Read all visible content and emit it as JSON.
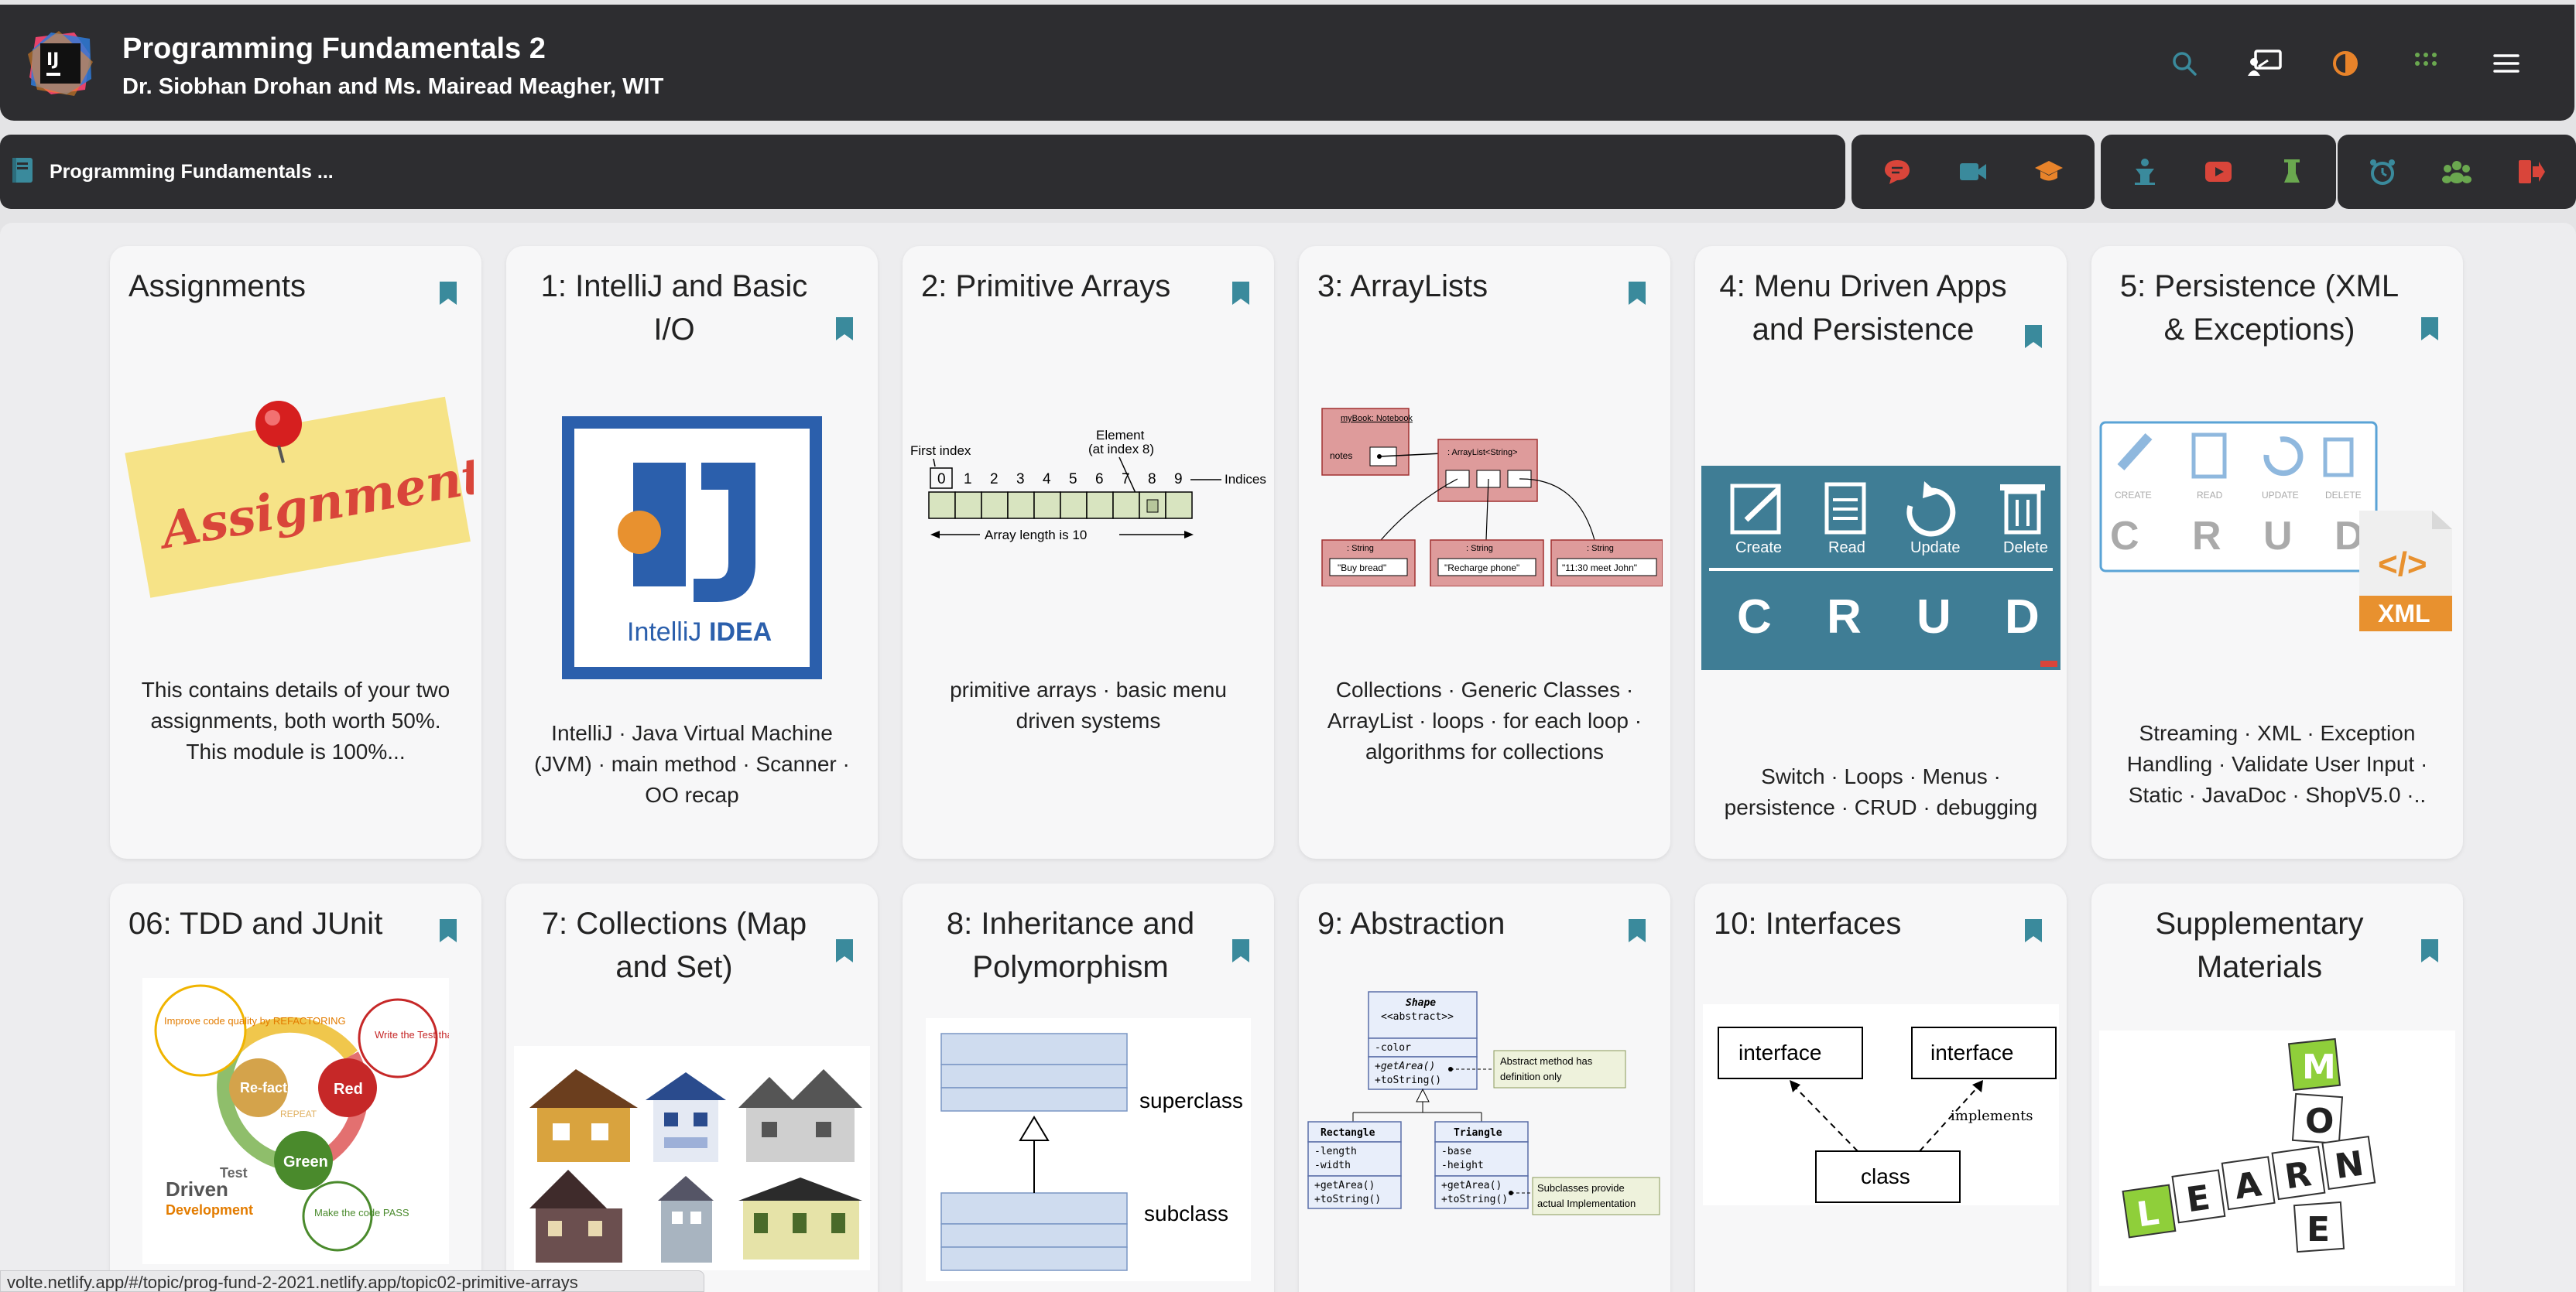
{
  "header": {
    "logo_text": "IJ",
    "title": "Programming Fundamentals 2",
    "subtitle": "Dr. Siobhan Drohan and Ms. Mairead Meagher, WIT",
    "icons": [
      "search-icon",
      "presentation-icon",
      "theme-toggle-icon",
      "apps-grid-icon",
      "menu-icon"
    ]
  },
  "nav": {
    "title": "Programming Fundamentals ...",
    "group1": [
      "chat-icon",
      "video-icon",
      "graduation-cap-icon"
    ],
    "group2": [
      "person-icon",
      "youtube-icon",
      "beaker-icon"
    ],
    "group3": [
      "alarm-icon",
      "group-icon",
      "logout-icon"
    ]
  },
  "colors": {
    "header_bg": "#2d2d30",
    "accent_teal": "#3a8a9c",
    "accent_orange": "#e8832a",
    "accent_red": "#d9453a",
    "accent_green": "#4caf50"
  },
  "cards": [
    {
      "title": "Assignments",
      "desc": "This contains details of your two assignments, both worth 50%. This module is 100%..."
    },
    {
      "title": "1: IntelliJ and Basic I/O",
      "desc": "IntelliJ · Java Virtual Machine (JVM) · main method · Scanner · OO recap"
    },
    {
      "title": "2: Primitive Arrays",
      "desc": "primitive arrays · basic menu driven systems"
    },
    {
      "title": "3: ArrayLists",
      "desc": "Collections · Generic Classes · ArrayList · loops · for each loop · algorithms for collections"
    },
    {
      "title": "4: Menu Driven Apps and Persistence",
      "desc": "Switch · Loops · Menus · persistence · CRUD · debugging"
    },
    {
      "title": "5: Persistence (XML & Exceptions)",
      "desc": "Streaming · XML · Exception Handling · Validate User Input · Static · JavaDoc · ShopV5.0 ·.."
    },
    {
      "title": "06: TDD and JUnit",
      "desc": ""
    },
    {
      "title": "7: Collections (Map and Set)",
      "desc": ""
    },
    {
      "title": "8: Inheritance and Polymorphism",
      "desc": ""
    },
    {
      "title": "9: Abstraction",
      "desc": ""
    },
    {
      "title": "10: Interfaces",
      "desc": ""
    },
    {
      "title": "Supplementary Materials",
      "desc": ""
    }
  ],
  "images": {
    "assignment_note": "Assignment",
    "intellij_logo_letters": "IJ",
    "intellij_logo_word1": "IntelliJ",
    "intellij_logo_word2": "IDEA",
    "array_first_index": "First index",
    "array_element": "Element",
    "array_element_sub": "(at index 8)",
    "array_indices": "Indices",
    "array_length": "Array length is 10",
    "array_digits": [
      "0",
      "1",
      "2",
      "3",
      "4",
      "5",
      "6",
      "7",
      "8",
      "9"
    ],
    "al_notebook": "myBook: Notebook",
    "al_notes": "notes",
    "al_arraylist": ": ArrayList<String>",
    "al_string": ": String",
    "al_s1": "\"Buy bread\"",
    "al_s2": "\"Recharge phone\"",
    "al_s3": "\"11:30 meet John\"",
    "crud_create": "Create",
    "crud_read": "Read",
    "crud_update": "Update",
    "crud_delete": "Delete",
    "crud_c": "C",
    "crud_r": "R",
    "crud_u": "U",
    "crud_d": "D",
    "crud2_create": "CREATE",
    "crud2_read": "READ",
    "crud2_update": "UPDATE",
    "crud2_delete": "DELETE",
    "xml_label": "XML",
    "xml_tag": "</>",
    "tdd_improve": "Improve code quality by REFACTORING",
    "tdd_write": "Write the Test that FAILs",
    "tdd_refactor": "Re-factor",
    "tdd_red": "Red",
    "tdd_repeat": "REPEAT",
    "tdd_green": "Green",
    "tdd_test": "Test",
    "tdd_driven": "Driven",
    "tdd_development": "Development",
    "tdd_pass": "Make the code PASS",
    "inh_superclass": "superclass",
    "inh_subclass": "subclass",
    "abs_shape": "Shape",
    "abs_abstract": "<<abstract>>",
    "abs_color": "-color",
    "abs_getarea": "+getArea()",
    "abs_tostring": "+toString()",
    "abs_note1a": "Abstract method has",
    "abs_note1b": "definition only",
    "abs_rect": "Rectangle",
    "abs_tri": "Triangle",
    "abs_length": "-length",
    "abs_width": "-width",
    "abs_base": "-base",
    "abs_height": "-height",
    "abs_note2a": "Subclasses provide",
    "abs_note2b": "actual Implementation",
    "int_interface": "interface",
    "int_class": "class",
    "int_implements": "implements",
    "learn_word": "LEARN",
    "more_m": "M",
    "more_o": "O",
    "more_r": "R",
    "more_e": "E"
  },
  "status_url": "volte.netlify.app/#/topic/prog-fund-2-2021.netlify.app/topic02-primitive-arrays"
}
